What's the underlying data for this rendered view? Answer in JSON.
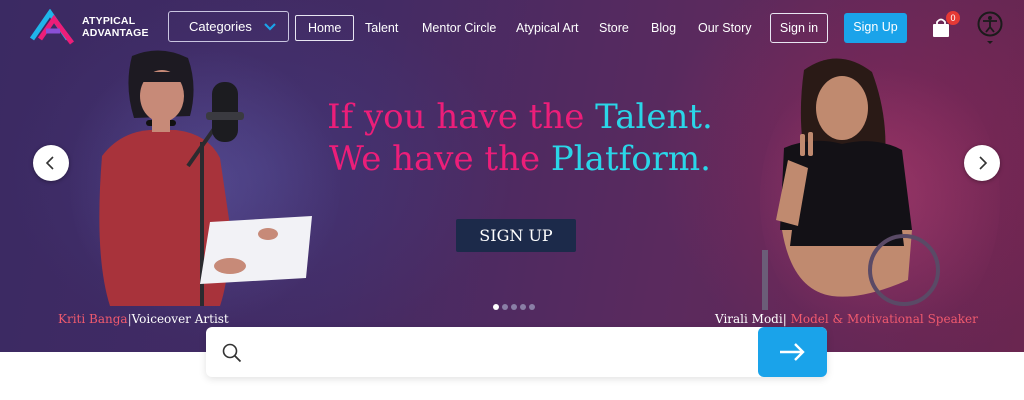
{
  "brand": {
    "name_line1": "ATYPICAL",
    "name_line2": "ADVANTAGE",
    "accent": "#1aa3ea",
    "pink": "#ec1e79",
    "cyan": "#2ad6e8"
  },
  "nav": {
    "categories_label": "Categories",
    "links": [
      "Home",
      "Talent",
      "Mentor Circle",
      "Atypical Art",
      "Store",
      "Blog",
      "Our Story"
    ],
    "active": "Home",
    "signin_label": "Sign in",
    "signup_label": "Sign Up",
    "cart_count": "0",
    "cart_icon": "shopping-bag-icon",
    "accessibility_icon": "accessibility-icon"
  },
  "hero": {
    "line1_a": "If you have the ",
    "line1_b": "Talent.",
    "line2_a": "We have the ",
    "line2_b": "Platform.",
    "signup_label": "SIGN UP",
    "slide_count": 5,
    "active_slide": 1,
    "left_caption": {
      "name": "Kriti Banga",
      "separator": "|",
      "role": "Voiceover Artist"
    },
    "right_caption": {
      "name": "Virali Modi",
      "separator": "|",
      "role": "Model & Motivational Speaker"
    }
  },
  "search": {
    "placeholder": "",
    "value": ""
  }
}
